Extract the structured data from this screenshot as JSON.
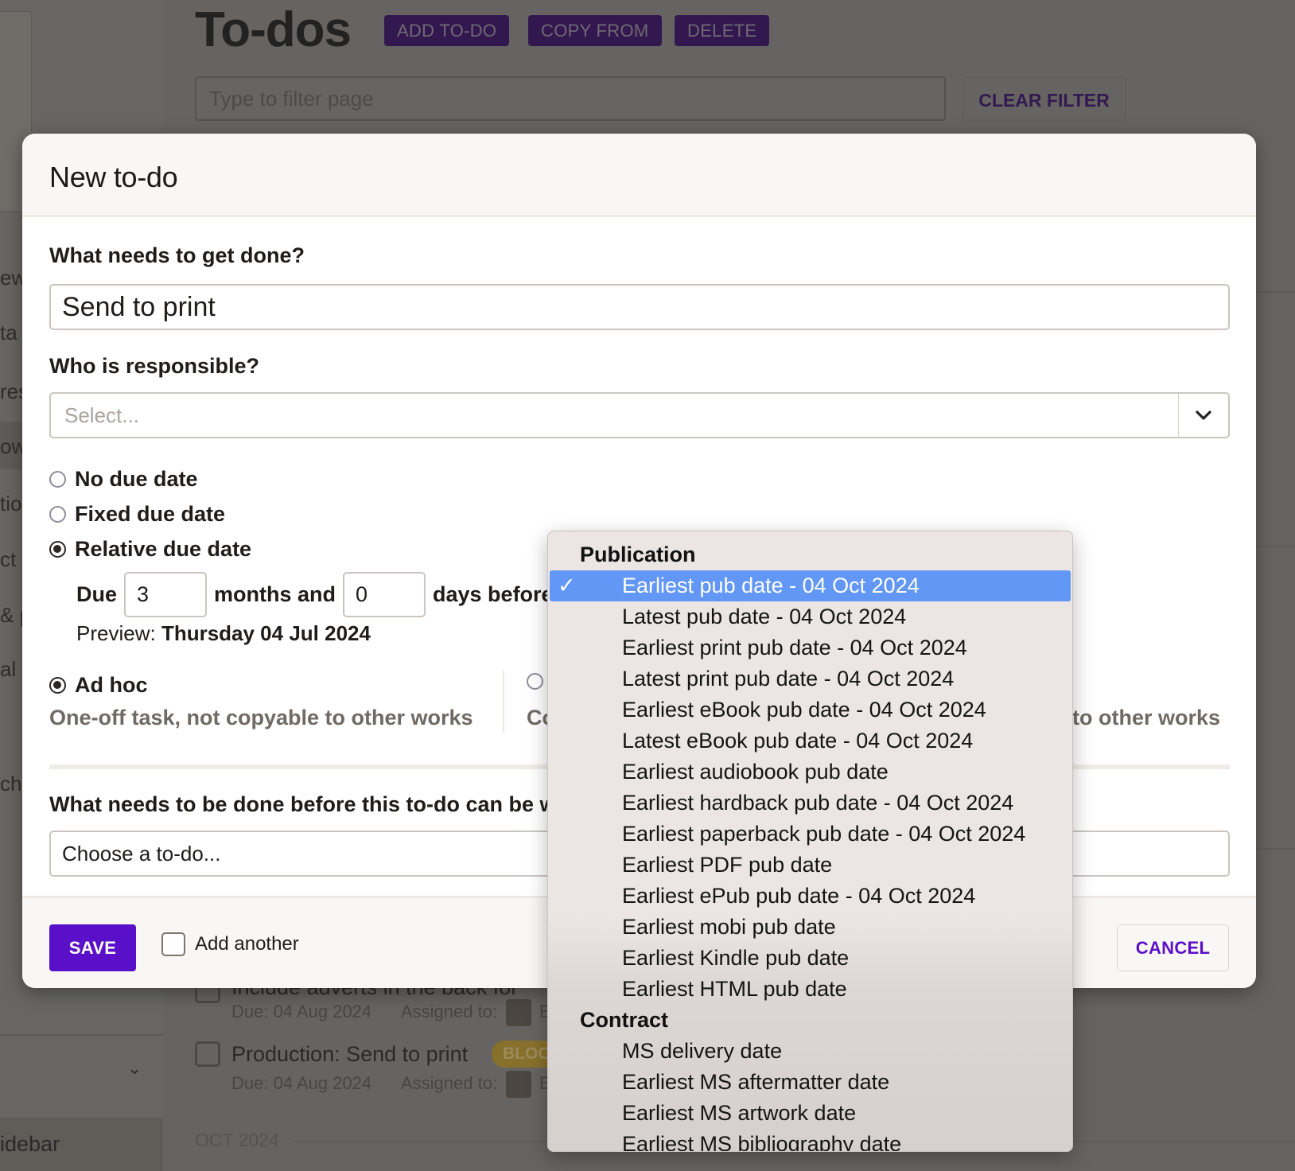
{
  "background": {
    "page_title": "To-dos",
    "header_buttons": [
      "ADD TO-DO",
      "COPY FROM",
      "DELETE"
    ],
    "filter_placeholder": "Type to filter page",
    "clear_filter": "CLEAR FILTER",
    "sidebar_fragments": [
      "ew",
      "ta",
      "res",
      "ow",
      "tio",
      "ct",
      "& p",
      "al",
      "ch"
    ],
    "sidebar_bottom": "idebar",
    "tasks": [
      {
        "title": "Include adverts in the back for",
        "due": "Due: 04 Aug 2024",
        "assigned_label": "Assigned to:",
        "assignee_initial": "E"
      },
      {
        "title": "Production: Send to print",
        "badge": "BLOCKED",
        "due": "Due: 04 Aug 2024",
        "assigned_label": "Assigned to:",
        "assignee_initial": "E"
      }
    ],
    "month_heading": "OCT 2024"
  },
  "modal": {
    "title": "New to-do",
    "what_label": "What needs to get done?",
    "what_value": "Send to print",
    "who_label": "Who is responsible?",
    "who_placeholder": "Select...",
    "due_options": [
      {
        "label": "No due date",
        "checked": false
      },
      {
        "label": "Fixed due date",
        "checked": false
      },
      {
        "label": "Relative due date",
        "checked": true
      }
    ],
    "due_prefix": "Due",
    "months_value": "3",
    "months_label": "months and",
    "days_value": "0",
    "days_label": "days before",
    "preview_label": "Preview:",
    "preview_value": "Thursday 04 Jul 2024",
    "type_options": [
      {
        "label": "Ad hoc",
        "description": "One-off task, not copyable to other works",
        "checked": true
      },
      {
        "label": "Co",
        "description": "Co… to other works",
        "checked": false
      }
    ],
    "type_option2_desc_tail": "to other works",
    "type_option2_desc_head": "Co",
    "blocker_label": "What needs to be done before this to-do can be w",
    "blocker_placeholder": "Choose a to-do...",
    "save": "SAVE",
    "add_another": "Add another",
    "add_another_checked": false,
    "cancel": "CANCEL"
  },
  "dropdown": {
    "groups": [
      {
        "label": "Publication",
        "items": [
          {
            "label": "Earliest pub date - 04 Oct 2024",
            "selected": true
          },
          {
            "label": "Latest pub date - 04 Oct 2024"
          },
          {
            "label": "Earliest print pub date - 04 Oct 2024"
          },
          {
            "label": "Latest print pub date - 04 Oct 2024"
          },
          {
            "label": "Earliest eBook pub date - 04 Oct 2024"
          },
          {
            "label": "Latest eBook pub date - 04 Oct 2024"
          },
          {
            "label": "Earliest audiobook pub date"
          },
          {
            "label": "Earliest hardback pub date - 04 Oct 2024"
          },
          {
            "label": "Earliest paperback pub date - 04 Oct 2024"
          },
          {
            "label": "Earliest PDF pub date"
          },
          {
            "label": "Earliest ePub pub date - 04 Oct 2024"
          },
          {
            "label": "Earliest mobi pub date"
          },
          {
            "label": "Earliest Kindle pub date"
          },
          {
            "label": "Earliest HTML pub date"
          }
        ]
      },
      {
        "label": "Contract",
        "items": [
          {
            "label": "MS delivery date"
          },
          {
            "label": "Earliest MS aftermatter date"
          },
          {
            "label": "Earliest MS artwork date"
          },
          {
            "label": "Earliest MS bibliography date"
          }
        ]
      }
    ],
    "check_glyph": "✓"
  },
  "colors": {
    "primary": "#5a0fc8",
    "selection": "#6297f5",
    "overlay": "#656462"
  }
}
